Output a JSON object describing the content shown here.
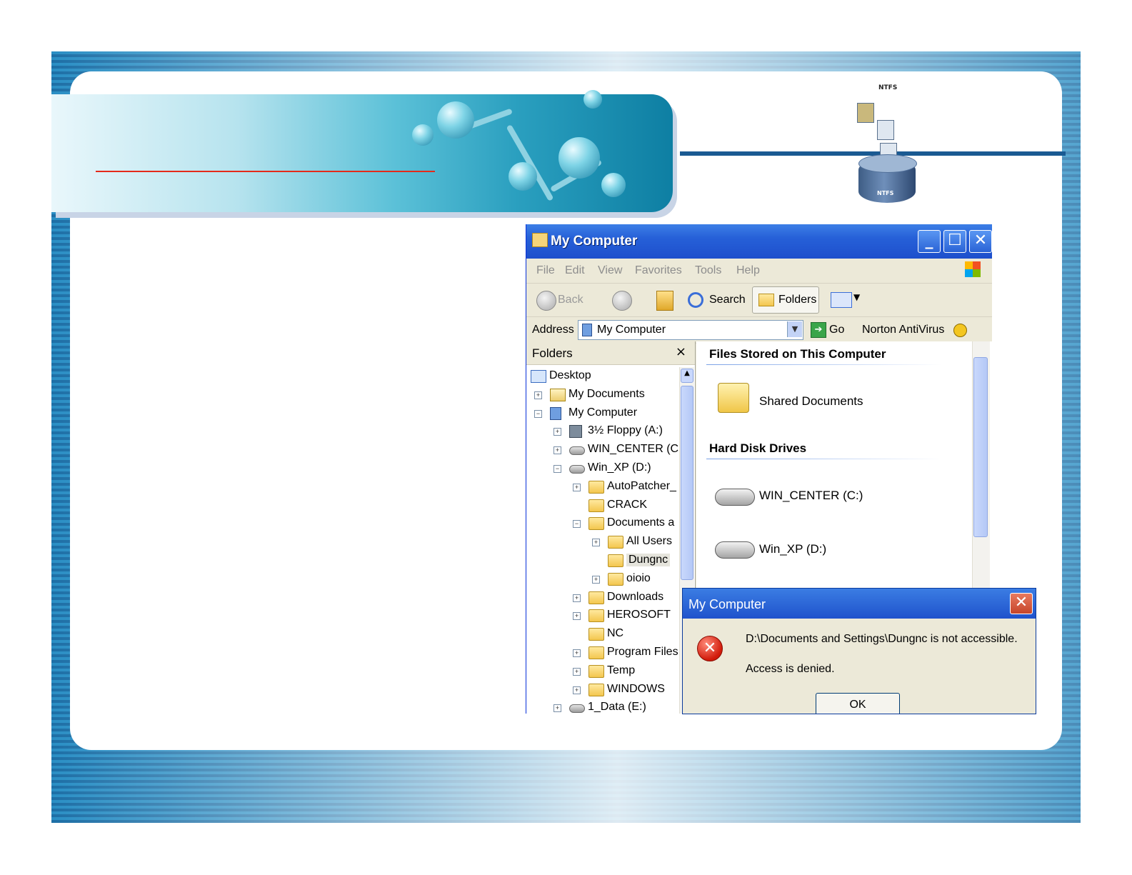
{
  "ntfs": {
    "top_label": "NTFS",
    "drum_label": "NTFS"
  },
  "window": {
    "title": "My Computer",
    "controls": {
      "minimize": "_",
      "maximize": "☐",
      "close": "✕"
    },
    "menu": [
      "File",
      "Edit",
      "View",
      "Favorites",
      "Tools",
      "Help"
    ],
    "toolbar": {
      "back": "Back",
      "search": "Search",
      "folders": "Folders"
    },
    "address": {
      "label": "Address",
      "value": "My Computer",
      "go": "Go",
      "norton": "Norton AntiVirus"
    }
  },
  "folders_pane": {
    "title": "Folders",
    "close": "×",
    "tree": [
      {
        "label": "Desktop",
        "icon": "desktop"
      },
      {
        "label": "My Documents",
        "icon": "mydocs",
        "expander": "+"
      },
      {
        "label": "My Computer",
        "icon": "mycomp",
        "expander": "−"
      },
      {
        "label": "3½ Floppy (A:)",
        "icon": "floppy",
        "expander": "+"
      },
      {
        "label": "WIN_CENTER (C",
        "icon": "drive",
        "expander": "+"
      },
      {
        "label": "Win_XP (D:)",
        "icon": "drive",
        "expander": "−"
      },
      {
        "label": "AutoPatcher_",
        "icon": "folder",
        "expander": "+"
      },
      {
        "label": "CRACK",
        "icon": "folder"
      },
      {
        "label": "Documents a",
        "icon": "folder",
        "expander": "−"
      },
      {
        "label": "All Users",
        "icon": "folder",
        "expander": "+"
      },
      {
        "label": "Dungnc",
        "icon": "folder",
        "selected": true
      },
      {
        "label": "oioio",
        "icon": "folder",
        "expander": "+"
      },
      {
        "label": "Downloads",
        "icon": "folder",
        "expander": "+"
      },
      {
        "label": "HEROSOFT",
        "icon": "folder",
        "expander": "+"
      },
      {
        "label": "NC",
        "icon": "folder"
      },
      {
        "label": "Program Files",
        "icon": "folder",
        "expander": "+"
      },
      {
        "label": "Temp",
        "icon": "folder",
        "expander": "+"
      },
      {
        "label": "WINDOWS",
        "icon": "folder",
        "expander": "+"
      },
      {
        "label": "1_Data (E:)",
        "icon": "drive",
        "expander": "+"
      }
    ]
  },
  "content": {
    "section_files": "Files Stored on This Computer",
    "shared_documents": "Shared Documents",
    "section_drives": "Hard Disk Drives",
    "drives": [
      "WIN_CENTER (C:)",
      "Win_XP (D:)"
    ]
  },
  "dialog": {
    "title": "My Computer",
    "close": "✕",
    "message": "D:\\Documents and Settings\\Dungnc is not accessible.",
    "detail": "Access is denied.",
    "ok": "OK",
    "icon": "error-icon"
  },
  "colors": {
    "title_blue": "#2660d8",
    "slide_blue": "#1d6fa6",
    "accent_red": "#e42a1a"
  }
}
